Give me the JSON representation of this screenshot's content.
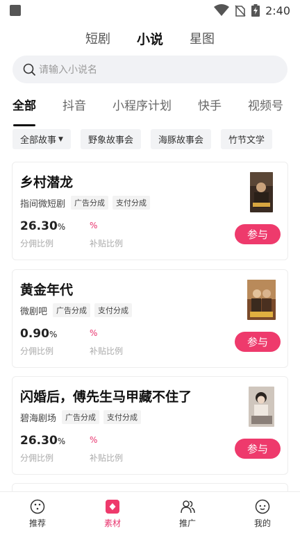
{
  "status": {
    "time": "2:40"
  },
  "top_tabs": [
    {
      "label": "短剧"
    },
    {
      "label": "小说"
    },
    {
      "label": "星图"
    }
  ],
  "search": {
    "placeholder": "请输入小说名"
  },
  "platform_tabs": [
    {
      "label": "全部"
    },
    {
      "label": "抖音"
    },
    {
      "label": "小程序计划"
    },
    {
      "label": "快手"
    },
    {
      "label": "视频号"
    }
  ],
  "filters": [
    {
      "label": "全部故事"
    },
    {
      "label": "野象故事会"
    },
    {
      "label": "海豚故事会"
    },
    {
      "label": "竹节文学"
    }
  ],
  "cards": [
    {
      "title": "乡村潜龙",
      "source": "指间微短剧",
      "tags": [
        "广告分成",
        "支付分成"
      ],
      "rate": "26.30",
      "rate_unit": "%",
      "rate_label": "分佣比例",
      "subsidy": "%",
      "subsidy_label": "补贴比例",
      "button": "参与"
    },
    {
      "title": "黄金年代",
      "source": "微剧吧",
      "tags": [
        "广告分成",
        "支付分成"
      ],
      "rate": "0.90",
      "rate_unit": "%",
      "rate_label": "分佣比例",
      "subsidy": "%",
      "subsidy_label": "补贴比例",
      "button": "参与"
    },
    {
      "title": "闪婚后，傅先生马甲藏不住了",
      "source": "碧海剧场",
      "tags": [
        "广告分成",
        "支付分成"
      ],
      "rate": "26.30",
      "rate_unit": "%",
      "rate_label": "分佣比例",
      "subsidy": "%",
      "subsidy_label": "补贴比例",
      "button": "参与"
    }
  ],
  "bottom_nav": [
    {
      "label": "推荐",
      "icon": "dice-icon"
    },
    {
      "label": "素材",
      "icon": "material-icon"
    },
    {
      "label": "推广",
      "icon": "users-icon"
    },
    {
      "label": "我的",
      "icon": "face-icon"
    }
  ],
  "colors": {
    "accent": "#ee3a6c",
    "text": "#222222"
  }
}
